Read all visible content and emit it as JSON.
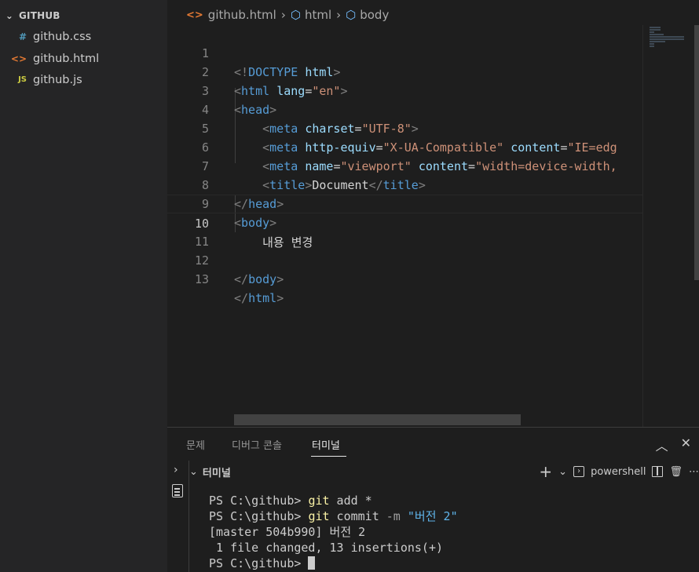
{
  "sidebar": {
    "folder_name": "GITHUB",
    "files": [
      {
        "icon": "css-file-icon",
        "glyph": "#",
        "name": "github.css"
      },
      {
        "icon": "html-file-icon",
        "glyph": "<>",
        "name": "github.html"
      },
      {
        "icon": "js-file-icon",
        "glyph": "JS",
        "name": "github.js"
      }
    ]
  },
  "breadcrumb": {
    "file": "github.html",
    "items": [
      "html",
      "body"
    ]
  },
  "editor": {
    "active_line": 10,
    "lines": [
      {
        "num": "1",
        "text": "<!DOCTYPE html>"
      },
      {
        "num": "2",
        "text": "<html lang=\"en\">"
      },
      {
        "num": "3",
        "text": "<head>"
      },
      {
        "num": "4",
        "text": "<meta charset=\"UTF-8\">"
      },
      {
        "num": "5",
        "text": "<meta http-equiv=\"X-UA-Compatible\" content=\"IE=edg"
      },
      {
        "num": "6",
        "text": "<meta name=\"viewport\" content=\"width=device-width,"
      },
      {
        "num": "7",
        "text": "<title>Document</title>"
      },
      {
        "num": "8",
        "text": "</head>"
      },
      {
        "num": "9",
        "text": "<body>"
      },
      {
        "num": "10",
        "text": "내용 변경"
      },
      {
        "num": "11",
        "text": ""
      },
      {
        "num": "12",
        "text": "</body>"
      },
      {
        "num": "13",
        "text": "</html>"
      }
    ]
  },
  "panel": {
    "tabs": [
      "문제",
      "디버그 콘솔",
      "터미널"
    ],
    "active_tab": "터미널",
    "terminal_label": "터미널",
    "shell_name": "powershell",
    "terminal_lines": [
      {
        "prompt": "PS C:\\github> ",
        "cmd": "git",
        "args": " add *",
        "flag": "",
        "str": ""
      },
      {
        "prompt": "PS C:\\github> ",
        "cmd": "git",
        "args": " commit ",
        "flag": "-m",
        "str": " \"버전 2\""
      },
      {
        "output": "[master 504b990] 버전 2"
      },
      {
        "output": " 1 file changed, 13 insertions(+)"
      },
      {
        "prompt": "PS C:\\github> ",
        "cursor": true
      }
    ]
  },
  "colors": {
    "background": "#1e1e1e",
    "sidebar": "#252526",
    "tag": "#569cd6",
    "attribute": "#9cdcfe",
    "string": "#ce9178",
    "command": "#f9f1a5"
  }
}
